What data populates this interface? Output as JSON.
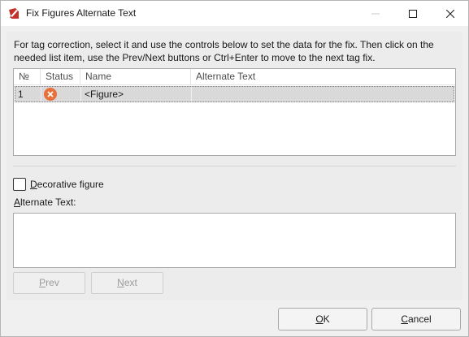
{
  "window": {
    "title": "Fix Figures Alternate Text",
    "icon": "pdf-app-icon",
    "controls": {
      "minimize": "minimize-icon",
      "maximize": "maximize-icon",
      "close": "close-icon"
    }
  },
  "instructions": "For tag correction, select it and use the controls below to set the data for the fix. Then click on the needed list item, use the Prev/Next buttons or Ctrl+Enter to move to the next tag fix.",
  "table": {
    "columns": [
      "№",
      "Status",
      "Name",
      "Alternate Text"
    ],
    "rows": [
      {
        "no": "1",
        "status": "error-icon",
        "name": "<Figure>",
        "alt": ""
      }
    ]
  },
  "decorative": {
    "label_pre": "",
    "label_mnemonic": "D",
    "label_post": "ecorative figure",
    "checked": false
  },
  "alt_text": {
    "label_mnemonic": "A",
    "label_post": "lternate Text:",
    "value": ""
  },
  "buttons": {
    "prev_mnemonic": "P",
    "prev_rest": "rev",
    "next_mnemonic": "N",
    "next_rest": "ext",
    "ok_mnemonic": "O",
    "ok_rest": "K",
    "cancel_mnemonic": "C",
    "cancel_rest": "ancel"
  },
  "colors": {
    "status_error": "#e8703b",
    "selection": "#d9d9d9",
    "app_icon": "#c4312b"
  }
}
